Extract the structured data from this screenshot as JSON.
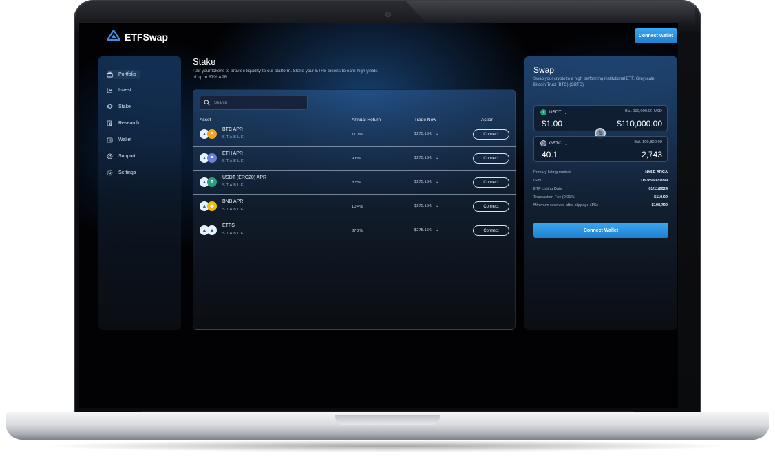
{
  "app": {
    "name": "ETFSwap",
    "header_button": "Connect Wallet"
  },
  "sidebar": {
    "items": [
      {
        "label": "Portfolio",
        "icon": "portfolio-icon",
        "active": true
      },
      {
        "label": "Invest",
        "icon": "chart-icon"
      },
      {
        "label": "Stake",
        "icon": "layers-icon"
      },
      {
        "label": "Research",
        "icon": "research-icon"
      },
      {
        "label": "Wallet",
        "icon": "wallet-icon"
      },
      {
        "label": "Support",
        "icon": "support-icon"
      },
      {
        "label": "Settings",
        "icon": "gear-icon"
      }
    ]
  },
  "stake": {
    "title": "Stake",
    "description": "Pair your tokens to provide liquidity to our platform. Stake your ETFS tokens to earn high yields of up to 87% APR.",
    "search_placeholder": "Search",
    "columns": [
      "Asset",
      "Annual Return",
      "Trade Now",
      "Action"
    ],
    "rows": [
      {
        "name": "BTC APR",
        "sub": "STABLE",
        "ret": "11.7%",
        "trade": "$275.16K",
        "action": "Connect",
        "icon2": "B",
        "icon2_color": "#f2a51a"
      },
      {
        "name": "ETH APR",
        "sub": "STABLE",
        "ret": "9.6%",
        "trade": "$275.16K",
        "action": "Connect",
        "icon2": "Ξ",
        "icon2_color": "#6b7fd6"
      },
      {
        "name": "USDT (ERC20) APR",
        "sub": "STABLE",
        "ret": "8.5%",
        "trade": "$275.16K",
        "action": "Connect",
        "icon2": "T",
        "icon2_color": "#26a17b"
      },
      {
        "name": "BNB APR",
        "sub": "STABLE",
        "ret": "10.4%",
        "trade": "$275.16K",
        "action": "Connect",
        "icon2": "◆",
        "icon2_color": "#f0b90b"
      },
      {
        "name": "ETFS",
        "sub": "STABLE",
        "ret": "87.2%",
        "trade": "$275.16K",
        "action": "Connect",
        "icon2": "▲",
        "icon2_color": "#e9f1fb"
      }
    ]
  },
  "swap": {
    "title": "Swap",
    "description": "Swap your crypto to a high performing institutional ETF. Grayscale Bitcoin Trust (BTC) (GBTC)",
    "from": {
      "token": "USDT",
      "balance": "Bal. 110,000.00 USD",
      "left": "$1.00",
      "right": "$110,000.00"
    },
    "to": {
      "token": "GBTC",
      "balance": "Bal. 109,890.00",
      "left": "40.1",
      "right": "2,743"
    },
    "details": [
      {
        "k": "Primary listing market",
        "v": "NYSE ARCA"
      },
      {
        "k": "ISIN",
        "v": "US3896371099"
      },
      {
        "k": "ETF Listing Date",
        "v": "01/11/2024"
      },
      {
        "k": "Transaction Fee (0.01%)",
        "v": "$110.00"
      },
      {
        "k": "Minimum received after slippage (1%)",
        "v": "$108,790"
      }
    ],
    "button": "Connect Wallet"
  },
  "colors": {
    "accent": "#2a90e3",
    "background": "#020204"
  }
}
